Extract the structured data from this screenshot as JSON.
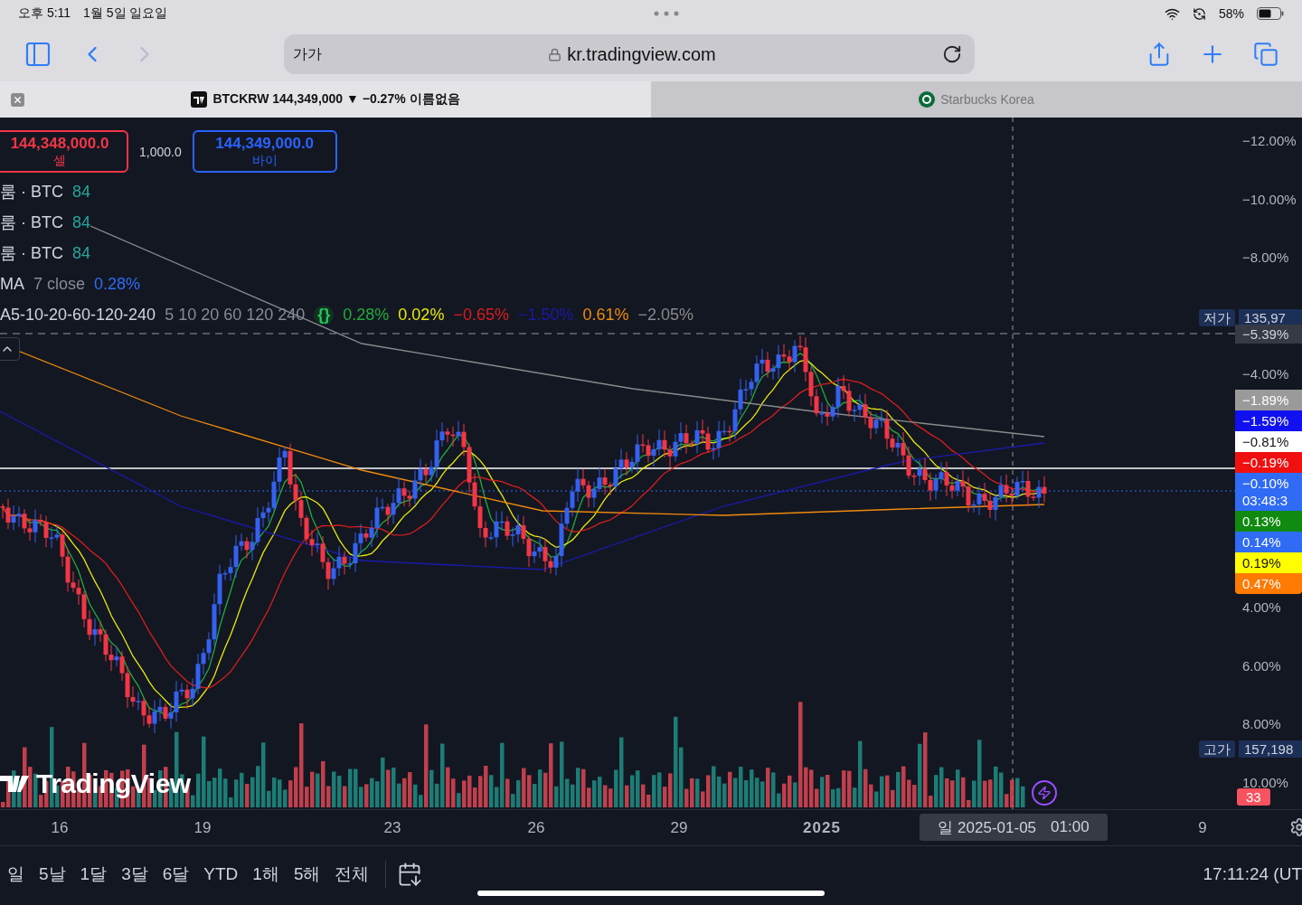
{
  "status_bar": {
    "time": "오후 5:11",
    "date": "1월 5일 일요일",
    "battery": "58%"
  },
  "browser": {
    "nav": [
      {
        "kind": "back",
        "disabled": false
      },
      {
        "kind": "forward",
        "disabled": true
      }
    ],
    "address": {
      "text_size": "가가",
      "url": "kr.tradingview.com"
    },
    "tabs": [
      {
        "kind": "chart",
        "title": "BTCKRW 144,349,000 ▼ −0.27% 이름없음",
        "selected": true
      },
      {
        "kind": "coffee",
        "title": "Starbucks Korea",
        "selected": false
      }
    ]
  },
  "chart": {
    "order_panel": {
      "sell": {
        "price": "144,348,000.0",
        "label": "셀"
      },
      "spread": "1,000.0",
      "buy": {
        "price": "144,349,000.0",
        "label": "바이"
      }
    },
    "legend": {
      "rows": [
        {
          "name": "룸 · BTC",
          "value": "84"
        },
        {
          "name": "룸 · BTC",
          "value": "84"
        },
        {
          "name": "룸 · BTC",
          "value": "84"
        }
      ],
      "ma": {
        "name": "MA",
        "params": "7 close",
        "value": "0.28%"
      },
      "multi_ma": {
        "name": "A5-10-20-60-120-240",
        "params": "5 10 20 60 120 240",
        "icon": "{}",
        "values": [
          {
            "text": "0.28%",
            "color": "#22ab3a"
          },
          {
            "text": "0.02%",
            "color": "#e8e80c"
          },
          {
            "text": "−0.65%",
            "color": "#d91d1d"
          },
          {
            "text": "−1.50%",
            "color": "#1a1aa8"
          },
          {
            "text": "0.61%",
            "color": "#f08a0c"
          },
          {
            "text": "−2.05%",
            "color": "#8a8a8a"
          }
        ]
      }
    },
    "logo_text": "TradingView",
    "price_axis": {
      "ticks": [
        "−12.00%",
        "−10.00%",
        "−8.00%",
        "−4.00%",
        "4.00%",
        "6.00%",
        "8.00%",
        "10.00%"
      ],
      "crosshair_value": "−5.39%",
      "low": {
        "label": "저가",
        "value": "135,97"
      },
      "high": {
        "label": "고가",
        "value": "157,198"
      },
      "tags": [
        {
          "text": "−1.89%",
          "color": "#9a9a9a"
        },
        {
          "text": "−1.59%",
          "color": "#1010f0"
        },
        {
          "text": "−0.81%",
          "color": "#ffffff"
        },
        {
          "text": "−0.19%",
          "color": "#f01010"
        },
        {
          "text": "−0.10%",
          "countdown": "03:48:3",
          "color": "#2f6bf5"
        },
        {
          "text": "0.13%",
          "color": "#108a10"
        },
        {
          "text": "0.14%",
          "color": "#2f6bf5"
        },
        {
          "text": "0.19%",
          "color": "#ffff00"
        },
        {
          "text": "0.47%",
          "color": "#ff7a00"
        }
      ],
      "volume": "33"
    },
    "time_axis": {
      "labels": [
        {
          "text": "16",
          "kind": "day"
        },
        {
          "text": "19",
          "kind": "day"
        },
        {
          "text": "23",
          "kind": "day"
        },
        {
          "text": "26",
          "kind": "day"
        },
        {
          "text": "29",
          "kind": "day"
        },
        {
          "text": "2025",
          "kind": "year"
        },
        {
          "text": "9",
          "kind": "day"
        }
      ],
      "crosshair": {
        "date": "일 2025-01-05",
        "time": "01:00"
      }
    }
  },
  "bottom_bar": {
    "ranges": [
      "일",
      "5날",
      "1달",
      "3달",
      "6달",
      "YTD",
      "1해",
      "5해",
      "전체"
    ],
    "clock": "17:11:24 (UT"
  }
}
